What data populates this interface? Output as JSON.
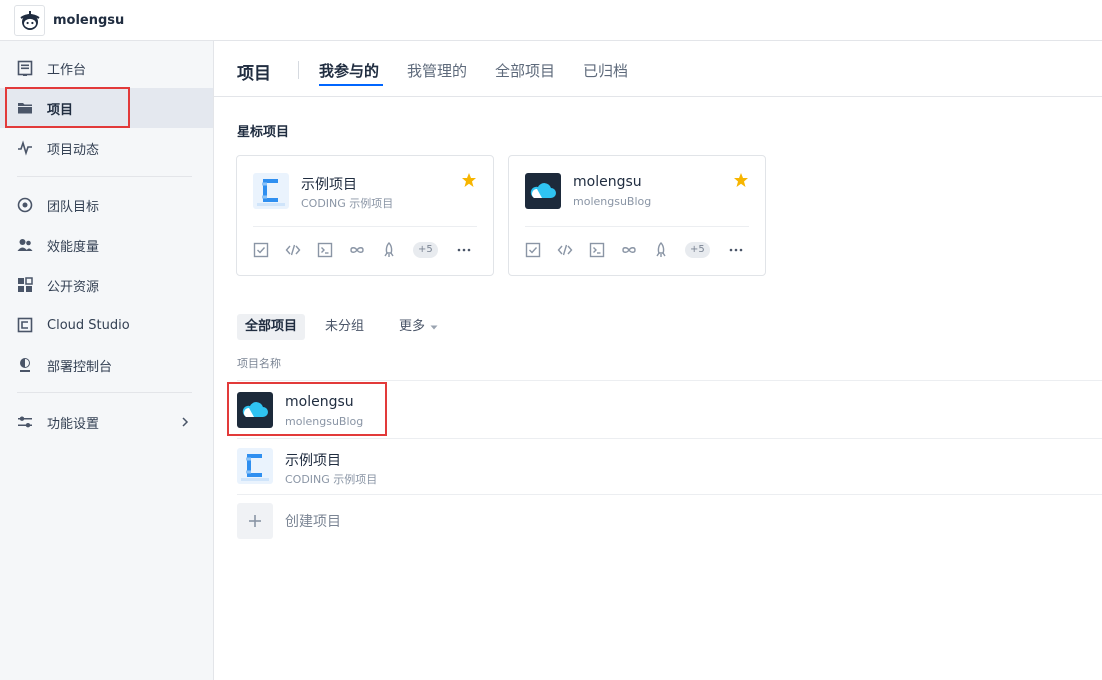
{
  "topbar": {
    "org_name": "molengsu"
  },
  "sidebar": {
    "items": [
      {
        "label": "工作台",
        "icon": "workbench-icon"
      },
      {
        "label": "项目",
        "icon": "folder-icon"
      },
      {
        "label": "项目动态",
        "icon": "activity-icon"
      },
      {
        "label": "团队目标",
        "icon": "target-icon"
      },
      {
        "label": "效能度量",
        "icon": "metrics-icon"
      },
      {
        "label": "公开资源",
        "icon": "resources-icon"
      },
      {
        "label": "Cloud Studio",
        "icon": "cloud-studio-icon"
      },
      {
        "label": "部署控制台",
        "icon": "deploy-icon"
      },
      {
        "label": "功能设置",
        "icon": "settings-sliders-icon"
      }
    ]
  },
  "header": {
    "title": "项目",
    "tabs": [
      {
        "label": "我参与的"
      },
      {
        "label": "我管理的"
      },
      {
        "label": "全部项目"
      },
      {
        "label": "已归档"
      }
    ]
  },
  "starred": {
    "title": "星标项目",
    "cards": [
      {
        "name": "示例项目",
        "subtitle": "CODING 示例项目",
        "more_count": "+5"
      },
      {
        "name": "molengsu",
        "subtitle": "molengsuBlog",
        "more_count": "+5"
      }
    ]
  },
  "filters": {
    "tabs": [
      {
        "label": "全部项目"
      },
      {
        "label": "未分组"
      },
      {
        "label": "更多"
      }
    ]
  },
  "list": {
    "column_header": "项目名称",
    "rows": [
      {
        "name": "molengsu",
        "subtitle": "molengsuBlog"
      },
      {
        "name": "示例项目",
        "subtitle": "CODING 示例项目"
      }
    ],
    "create_label": "创建项目"
  },
  "colors": {
    "accent": "#0066ff",
    "star": "#f7b500",
    "highlight_box": "#e23a3a",
    "sidebar_bg": "#f5f7f9"
  }
}
